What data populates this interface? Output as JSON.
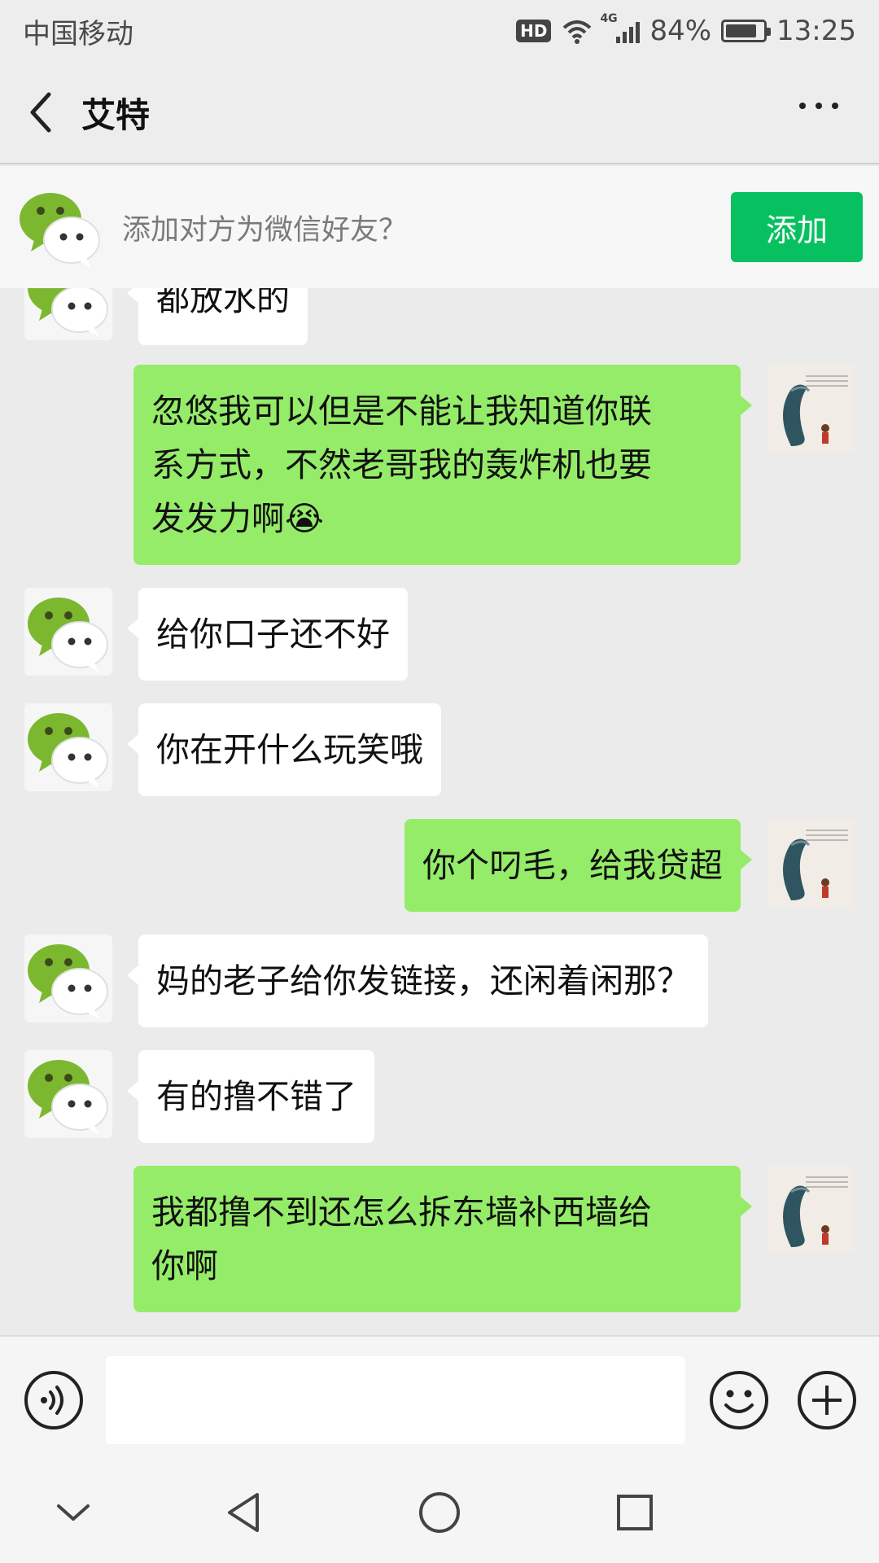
{
  "status_bar": {
    "carrier": "中国移动",
    "hd": "HD",
    "network": "4G",
    "battery_percent": "84%",
    "battery_level": 0.84,
    "time": "13:25",
    "icons": [
      "hd-icon",
      "wifi-icon",
      "signal-icon",
      "battery-icon"
    ]
  },
  "header": {
    "title": "艾特",
    "back_icon": "chevron-left-icon",
    "more_icon": "more-dots-icon"
  },
  "add_friend_banner": {
    "text": "添加对方为微信好友？",
    "button_label": "添加",
    "accent": "#07c160"
  },
  "messages": [
    {
      "sender": "them",
      "text": "都放水的"
    },
    {
      "sender": "me",
      "lines": [
        "忽悠我可以但是不能让我知道你联",
        "系方式，不然老哥我的轰炸机也要",
        "发发力啊"
      ],
      "emoji": "😭"
    },
    {
      "sender": "them",
      "text": "给你口子还不好"
    },
    {
      "sender": "them",
      "text": "你在开什么玩笑哦"
    },
    {
      "sender": "me",
      "text": "你个叼毛，给我贷超"
    },
    {
      "sender": "them",
      "text": "妈的老子给你发链接，还闲着闲那？"
    },
    {
      "sender": "them",
      "text": "有的撸不错了"
    },
    {
      "sender": "me",
      "lines": [
        "我都撸不到还怎么拆东墙补西墙给",
        "你啊"
      ]
    }
  ],
  "colors": {
    "incoming_bubble": "#ffffff",
    "outgoing_bubble": "#95ec69",
    "chat_background": "#ebebeb"
  },
  "input_bar": {
    "placeholder": "",
    "icons": [
      "voice-icon",
      "emoji-icon",
      "plus-icon"
    ]
  },
  "system_nav": {
    "icons": [
      "hide-keyboard-icon",
      "back-triangle-icon",
      "home-circle-icon",
      "recents-square-icon"
    ]
  }
}
